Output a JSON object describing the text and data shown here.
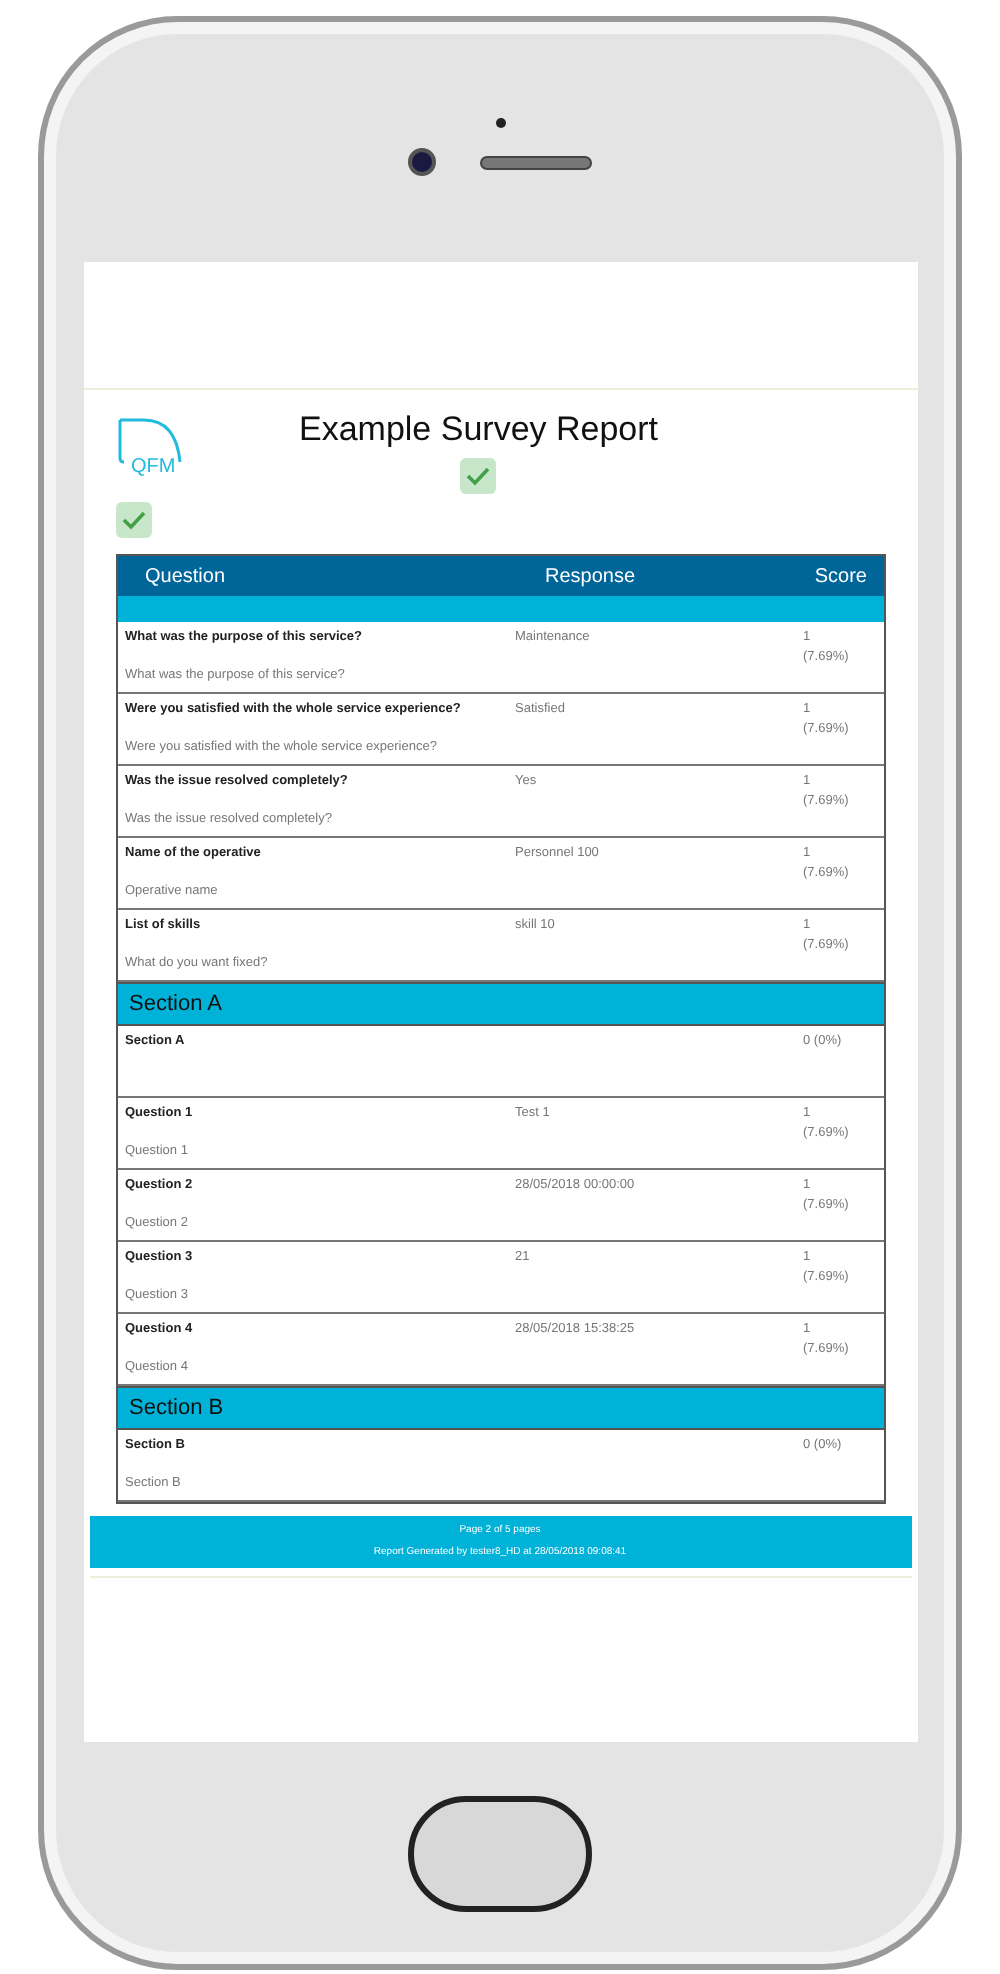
{
  "report": {
    "logo_text": "QFM",
    "title": "Example Survey Report",
    "checks": [
      {
        "checked": true
      },
      {
        "checked": true
      }
    ]
  },
  "table": {
    "columns": [
      "Question",
      "Response",
      "Score"
    ],
    "rows": [
      {
        "kind": "question",
        "question": "What was the purpose of this service?",
        "description": "What was the purpose of this service?",
        "response": "Maintenance",
        "score": "1",
        "percent": "(7.69%)"
      },
      {
        "kind": "question",
        "question": "Were you satisfied with the whole service experience?",
        "description": "Were you satisfied with the whole service experience?",
        "response": "Satisfied",
        "score": "1",
        "percent": "(7.69%)"
      },
      {
        "kind": "question",
        "question": "Was the issue resolved completely?",
        "description": "Was the issue resolved completely?",
        "response": "Yes",
        "score": "1",
        "percent": "(7.69%)"
      },
      {
        "kind": "question",
        "question": "Name of the operative",
        "description": "Operative name",
        "response": "Personnel 100",
        "score": "1",
        "percent": "(7.69%)"
      },
      {
        "kind": "question",
        "question": "List of skills",
        "description": "What do you want fixed?",
        "response": "skill 10",
        "score": "1",
        "percent": "(7.69%)"
      },
      {
        "kind": "section",
        "title": "Section A"
      },
      {
        "kind": "question",
        "question": "Section A",
        "score": "0 (0%)"
      },
      {
        "kind": "question",
        "question": "Question 1",
        "description": "Question 1",
        "response": "Test 1",
        "score": "1",
        "percent": "(7.69%)"
      },
      {
        "kind": "question",
        "question": "Question 2",
        "description": "Question 2",
        "response": "28/05/2018 00:00:00",
        "score": "1",
        "percent": "(7.69%)"
      },
      {
        "kind": "question",
        "question": "Question 3",
        "description": "Question 3",
        "response": "21",
        "score": "1",
        "percent": "(7.69%)"
      },
      {
        "kind": "question",
        "question": "Question 4",
        "description": "Question 4",
        "response": "28/05/2018 15:38:25",
        "score": "1",
        "percent": "(7.69%)"
      },
      {
        "kind": "section",
        "title": "Section B"
      },
      {
        "kind": "question",
        "question": "Section B",
        "description": "Section B",
        "score": "0 (0%)"
      }
    ]
  },
  "footer": {
    "page": "Page 2 of 5 pages",
    "generated": "Report Generated by tester8_HD at 28/05/2018 09:08:41"
  }
}
